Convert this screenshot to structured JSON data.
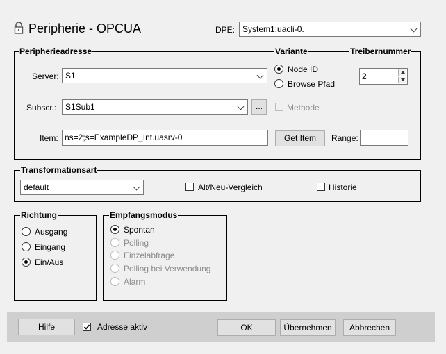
{
  "header": {
    "title": "Peripherie - OPCUA",
    "dpe_label": "DPE:",
    "dpe_value": "System1:uacli-0."
  },
  "address": {
    "legend": "Peripherieadresse",
    "server_label": "Server:",
    "server_value": "S1",
    "subscr_label": "Subscr.:",
    "subscr_value": "S1Sub1",
    "subscr_browse": "...",
    "item_label": "Item:",
    "item_value": "ns=2;s=ExampleDP_Int.uasrv-0",
    "get_item": "Get Item",
    "range_label": "Range:",
    "range_value": ""
  },
  "variante": {
    "legend": "Variante",
    "options": [
      "Node ID",
      "Browse Pfad"
    ],
    "selected": "Node ID",
    "methode": "Methode"
  },
  "treiber": {
    "legend": "Treibernummer",
    "value": "2"
  },
  "transformation": {
    "legend": "Transformationsart",
    "value": "default",
    "alt_neu": "Alt/Neu-Vergleich",
    "historie": "Historie"
  },
  "richtung": {
    "legend": "Richtung",
    "options": [
      "Ausgang",
      "Eingang",
      "Ein/Aus"
    ],
    "selected": "Ein/Aus"
  },
  "empfang": {
    "legend": "Empfangsmodus",
    "options": [
      "Spontan",
      "Polling",
      "Einzelabfrage",
      "Polling bei Verwendung",
      "Alarm"
    ],
    "selected": "Spontan"
  },
  "footer": {
    "hilfe": "Hilfe",
    "adresse_aktiv": "Adresse aktiv",
    "ok": "OK",
    "uebernehmen": "Übernehmen",
    "abbrechen": "Abbrechen"
  }
}
